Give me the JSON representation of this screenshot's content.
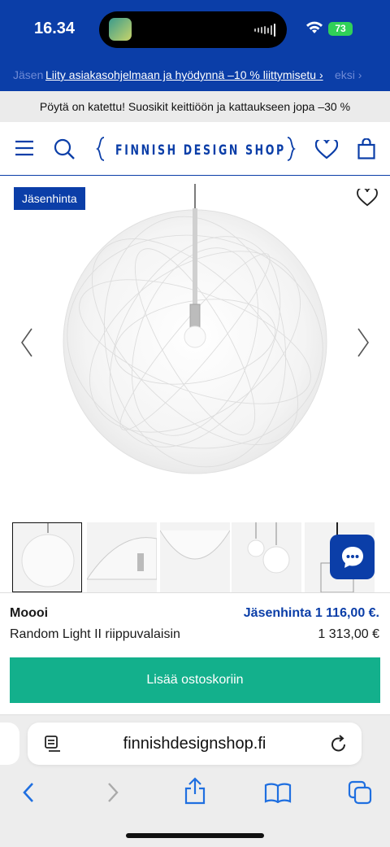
{
  "status": {
    "time": "16.34",
    "battery": "73"
  },
  "promo": {
    "ghost_left": "Jäsen",
    "text": "Liity asiakasohjelmaan ja hyödynnä –10 % liittymisetu ›",
    "ghost_right": "eksi ›"
  },
  "announcement": "Pöytä on katettu! Suosikit keittiöön ja kattaukseen jopa –30 %",
  "header": {
    "logo": "FINNISH DESIGN SHOP",
    "icons": [
      "menu-icon",
      "search-icon",
      "heart-icon",
      "bag-icon"
    ]
  },
  "product": {
    "badge": "Jäsenhinta",
    "brand": "Moooi",
    "name": "Random Light II riippuvalaisin",
    "member_price": "Jäsenhinta 1 116,00 €.",
    "price": "1 313,00 €",
    "add_to_cart": "Lisää ostoskoriin",
    "thumbnail_count": 5
  },
  "browser": {
    "url": "finnishdesignshop.fi",
    "toolbar": [
      "back-icon",
      "forward-icon",
      "share-icon",
      "bookmarks-icon",
      "tabs-icon"
    ]
  },
  "colors": {
    "brand_blue": "#0b3ea8",
    "cart_green": "#13b08c"
  }
}
